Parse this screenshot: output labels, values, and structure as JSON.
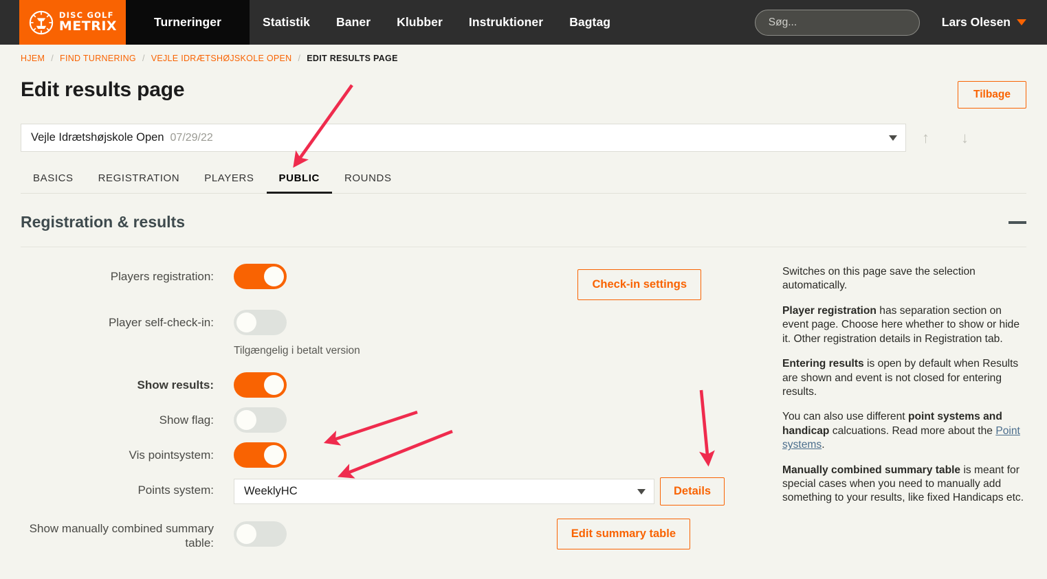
{
  "topnav": {
    "logo": {
      "line1": "DISC GOLF",
      "line2": "METRIX",
      "icon": "disc-golf-basket-icon"
    },
    "items": [
      {
        "label": "Turneringer",
        "active": true
      },
      {
        "label": "Statistik",
        "active": false
      },
      {
        "label": "Baner",
        "active": false
      },
      {
        "label": "Klubber",
        "active": false
      },
      {
        "label": "Instruktioner",
        "active": false
      },
      {
        "label": "Bagtag",
        "active": false
      }
    ],
    "search_placeholder": "Søg...",
    "search_value": "",
    "user_name": "Lars Olesen"
  },
  "breadcrumb": [
    {
      "label": "HJEM"
    },
    {
      "label": "FIND TURNERING"
    },
    {
      "label": "VEJLE IDRÆTSHØJSKOLE OPEN"
    },
    {
      "label": "EDIT RESULTS PAGE"
    }
  ],
  "header": {
    "title": "Edit results page",
    "back_button": "Tilbage"
  },
  "event_selector": {
    "name": "Vejle Idrætshøjskole Open",
    "date": "07/29/22",
    "up_arrow": "↑",
    "down_arrow": "↓"
  },
  "tabs": [
    {
      "label": "BASICS",
      "active": false
    },
    {
      "label": "REGISTRATION",
      "active": false
    },
    {
      "label": "PLAYERS",
      "active": false
    },
    {
      "label": "PUBLIC",
      "active": true
    },
    {
      "label": "ROUNDS",
      "active": false
    }
  ],
  "section": {
    "title": "Registration & results",
    "collapse_icon": "minus-icon"
  },
  "form": {
    "players_registration_label": "Players registration:",
    "players_registration_state": "on",
    "player_self_checkin_label": "Player self-check-in:",
    "player_self_checkin_state": "off",
    "player_self_checkin_hint": "Tilgængelig i betalt version",
    "checkin_settings_button": "Check-in settings",
    "show_results_label": "Show results:",
    "show_results_state": "on",
    "show_flag_label": "Show flag:",
    "show_flag_state": "off",
    "vis_pointsystem_label": "Vis pointsystem:",
    "vis_pointsystem_state": "on",
    "points_system_label": "Points system:",
    "points_system_value": "WeeklyHC",
    "details_button": "Details",
    "show_manual_summary_label": "Show manually combined summary table:",
    "show_manual_summary_state": "off",
    "edit_summary_button": "Edit summary table"
  },
  "help": {
    "p1": "Switches on this page save the selection automatically.",
    "p2_bold": "Player registration",
    "p2_rest": " has separation section on event page. Choose here whether to show or hide it. Other registration details in Registration tab.",
    "p3_bold": "Entering results",
    "p3_rest": " is open by default when Results are shown and event is not closed for entering results.",
    "p4_pre": "You can also use different ",
    "p4_bold": "point systems and handicap",
    "p4_mid": " calcuations. Read more about the ",
    "p4_link": "Point systems",
    "p4_end": ".",
    "p5_bold": "Manually combined summary table",
    "p5_rest": " is meant for special cases when you need to manually add something to your results, like fixed Handicaps etc."
  },
  "annotations": {
    "arrow_color": "#ef2b4d",
    "arrows": [
      {
        "name": "arrow-to-public-tab"
      },
      {
        "name": "arrow-to-vis-pointsystem-toggle"
      },
      {
        "name": "arrow-to-points-system-select"
      },
      {
        "name": "arrow-to-details-button"
      }
    ]
  },
  "colors": {
    "brand_orange": "#f96302",
    "nav_dark": "#2e2e2e",
    "page_bg": "#f4f4ee",
    "toggle_off": "#dfe2dd"
  }
}
